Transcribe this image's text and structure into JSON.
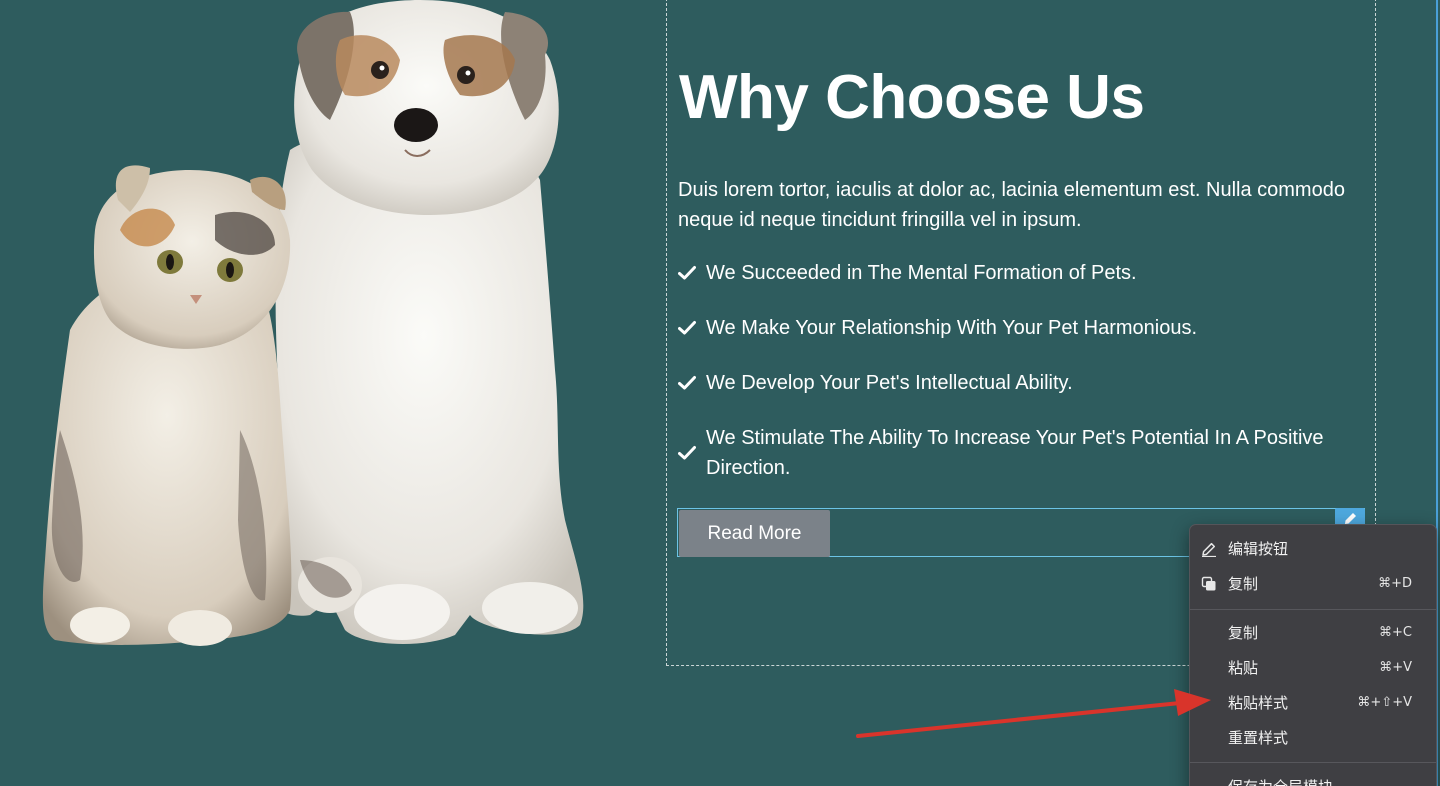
{
  "section": {
    "heading": "Why Choose Us",
    "intro": "Duis lorem tortor, iaculis at dolor ac, lacinia elementum est. Nulla commodo neque id neque tincidunt fringilla vel in ipsum.",
    "features": [
      "We Succeeded in The Mental Formation of Pets.",
      "We Make Your Relationship With Your Pet Harmonious.",
      "We Develop Your Pet's Intellectual Ability.",
      "We Stimulate The Ability To Increase Your Pet's Potential In A Positive Direction."
    ],
    "button_label": "Read More"
  },
  "context_menu": {
    "items": [
      {
        "label": "编辑按钮",
        "shortcut": "",
        "icon": "pencil-icon"
      },
      {
        "label": "复制",
        "shortcut": "⌘+D",
        "icon": "duplicate-icon"
      },
      {
        "label": "复制",
        "shortcut": "⌘+C",
        "icon": ""
      },
      {
        "label": "粘贴",
        "shortcut": "⌘+V",
        "icon": ""
      },
      {
        "label": "粘贴样式",
        "shortcut": "⌘+⇧+V",
        "icon": ""
      },
      {
        "label": "重置样式",
        "shortcut": "",
        "icon": ""
      },
      {
        "label": "保存为全局模块",
        "shortcut": "",
        "icon": ""
      }
    ]
  },
  "colors": {
    "background": "#2e5c5e",
    "button": "#7b8289",
    "selection": "#6cc4e6",
    "menu_background": "#3f3f43",
    "annotation_arrow": "#d9342b"
  }
}
